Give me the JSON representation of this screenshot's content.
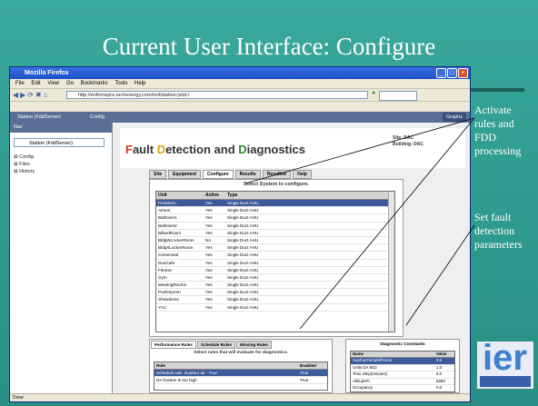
{
  "slide": {
    "title": "Current User Interface:  Configure",
    "annotation_1": [
      "Activate",
      "rules and",
      "FDD",
      "processing"
    ],
    "annotation_2": [
      "Set fault",
      "detection",
      "parameters"
    ],
    "logo_text": "ier"
  },
  "browser": {
    "title": "Mozilla Firefox",
    "menu": [
      "File",
      "Edit",
      "View",
      "Go",
      "Bookmarks",
      "Tools",
      "Help"
    ],
    "url": "http://enforcepro.archenergy.com/ord/station:|slot:/",
    "tabs": [
      "Station (FddServer)",
      "Config"
    ],
    "graph_tab": "Graphs",
    "status": "Done"
  },
  "left_panel": {
    "header": "Nav",
    "station": "Station (FddServer)",
    "tree": [
      "Config",
      "Files",
      "History"
    ]
  },
  "app": {
    "title_parts": [
      "F",
      "ault ",
      "D",
      "etection and ",
      "D",
      "iagnostics"
    ],
    "site_label": "Site:",
    "site_value": "DAC",
    "building_label": "Building:",
    "building_value": "DAC",
    "tabs": [
      "Site",
      "Equipment",
      "Configure",
      "Results",
      "Resulttxt",
      "Help"
    ],
    "active_tab": "Configure",
    "select_heading": "Select System to configure.",
    "systems_columns": [
      "Unit",
      "Active",
      "Type"
    ],
    "systems": [
      [
        "PenMoon",
        "Yes",
        "Single Duct AHU"
      ],
      [
        "Atrium",
        "Yes",
        "Single Duct AHU"
      ],
      [
        "Ballroom1",
        "Yes",
        "Single Duct AHU"
      ],
      [
        "Ballroom2",
        "Yes",
        "Single Duct AHU"
      ],
      [
        "BillardRoom",
        "Yes",
        "Single Duct AHU"
      ],
      [
        "BldgWLockerRoom",
        "No",
        "Single Duct AHU"
      ],
      [
        "BldgXLockerRoom",
        "Yes",
        "Single Duct AHU"
      ],
      [
        "Centennial",
        "Yes",
        "Single Duct AHU"
      ],
      [
        "DuoCafe",
        "Yes",
        "Single Duct AHU"
      ],
      [
        "Fitness",
        "Yes",
        "Single Duct AHU"
      ],
      [
        "Gym",
        "Yes",
        "Single Duct AHU"
      ],
      [
        "MeetingRooms",
        "Yes",
        "Single Duct AHU"
      ],
      [
        "PoolImprom",
        "Yes",
        "Single Duct AHU"
      ],
      [
        "Showdome",
        "Yes",
        "Single Duct AHU"
      ],
      [
        "YAC",
        "Yes",
        "Single Duct AHU"
      ]
    ],
    "rules_tabs": [
      "Performance Rules",
      "Schedule Rules",
      "Missing Rules"
    ],
    "rules_heading": "Select rules that will evaluate for diagnostics.",
    "rules_columns": [
      "Rule",
      "Enabled"
    ],
    "rules": [
      [
        "Schedule rule: Outdoor air - True",
        "True"
      ],
      [
        "DA fraction is too high",
        "True"
      ]
    ],
    "diag_heading": "Diagnostic Constants",
    "diag_columns": [
      "Name",
      "Value"
    ],
    "diag_rows": [
      [
        "SupFanTempDiffAtrAir",
        "0.5"
      ],
      [
        "Units  DA  SD2",
        "1.0"
      ],
      [
        "Time Step(minutes)",
        "5.0"
      ],
      [
        "AltitudeFt",
        "5280"
      ],
      [
        "Occupancy",
        "0.0"
      ]
    ]
  }
}
